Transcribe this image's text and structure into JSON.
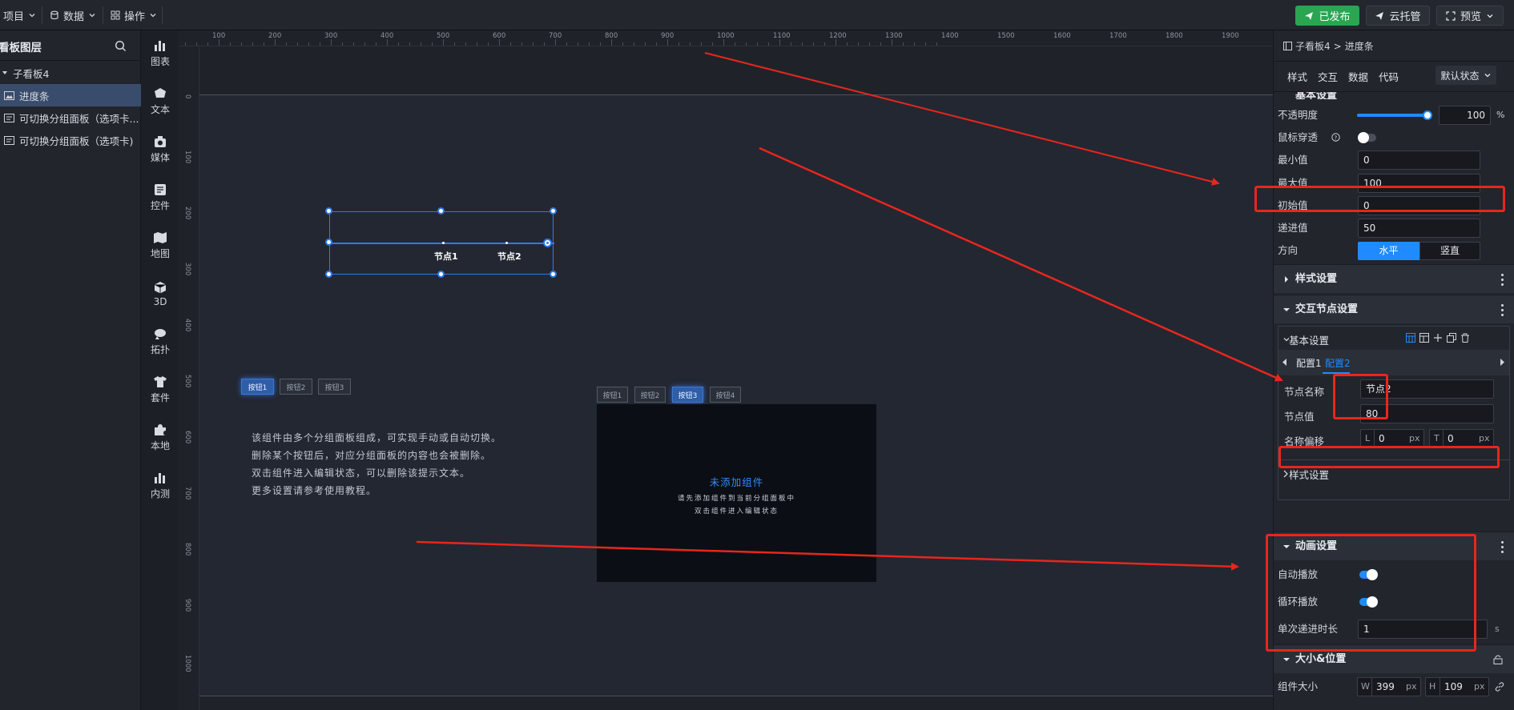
{
  "topbar": {
    "menus": [
      {
        "label": "项目",
        "icon": "menu-icon"
      },
      {
        "label": "数据",
        "icon": "database-icon"
      },
      {
        "label": "操作",
        "icon": "grid-icon"
      }
    ],
    "publish_label": "已发布",
    "hosting_label": "云托管",
    "preview_label": "预览"
  },
  "layers": {
    "title": "看板图层",
    "items": [
      {
        "label": "子看板4"
      },
      {
        "label": "进度条"
      },
      {
        "label": "可切换分组面板（选项卡..."
      },
      {
        "label": "可切换分组面板（选项卡)"
      }
    ]
  },
  "iconbar": {
    "items": [
      {
        "label": "图表",
        "icon": "chart-icon"
      },
      {
        "label": "文本",
        "icon": "text-icon"
      },
      {
        "label": "媒体",
        "icon": "media-icon"
      },
      {
        "label": "控件",
        "icon": "control-icon"
      },
      {
        "label": "地图",
        "icon": "map-icon"
      },
      {
        "label": "3D",
        "icon": "cube-icon"
      },
      {
        "label": "拓扑",
        "icon": "topology-icon"
      },
      {
        "label": "套件",
        "icon": "kit-icon"
      },
      {
        "label": "本地",
        "icon": "puzzle-icon"
      },
      {
        "label": "内测",
        "icon": "beta-chart-icon"
      }
    ]
  },
  "ruler": {
    "top_ticks": [
      "100",
      "200",
      "300",
      "400",
      "500",
      "600",
      "700",
      "800",
      "900",
      "1000",
      "1100",
      "1200",
      "1300",
      "1400",
      "1500",
      "1600",
      "1700",
      "1800",
      "1900"
    ],
    "left_ticks": [
      "0",
      "100",
      "200",
      "300",
      "400",
      "500",
      "600",
      "700",
      "800",
      "900",
      "1000"
    ]
  },
  "canvas": {
    "progress_nodes": [
      "节点1",
      "节点2"
    ],
    "tabs_left": [
      "按钮1",
      "按钮2",
      "按钮3"
    ],
    "description": [
      "该组件由多个分组面板组成，可实现手动或自动切换。",
      "删除某个按钮后，对应分组面板的内容也会被删除。",
      "双击组件进入编辑状态，可以删除该提示文本。",
      "更多设置请参考使用教程。"
    ],
    "tabs_right": [
      "按钮1",
      "按钮2",
      "按钮3",
      "按钮4"
    ],
    "empty_panel": {
      "title": "未添加组件",
      "line1": "请先添加组件到当前分组面板中",
      "line2": "双击组件进入编辑状态"
    }
  },
  "rpanel": {
    "breadcrumb_parent": "子看板4",
    "breadcrumb_sep": ">",
    "breadcrumb_current": "进度条",
    "tabs": [
      "样式",
      "交互",
      "数据",
      "代码"
    ],
    "state_select": "默认状态",
    "partial_section": "基本设置",
    "opacity_label": "不透明度",
    "opacity_value": "100",
    "opacity_unit": "%",
    "opacity_level": 1.0,
    "mouse_through_label": "鼠标穿透",
    "min_label": "最小值",
    "min_value": "0",
    "max_label": "最大值",
    "max_value": "100",
    "init_label": "初始值",
    "init_value": "0",
    "step_label": "递进值",
    "step_value": "50",
    "dir_label": "方向",
    "dir_h": "水平",
    "dir_v": "竖直",
    "style_section": "样式设置",
    "node_section": "交互节点设置",
    "basic_sub": "基本设置",
    "config_tabs": [
      "配置1",
      "配置2"
    ],
    "node_name_label": "节点名称",
    "node_name_value": "节点2",
    "node_value_label": "节点值",
    "node_value_value": "80",
    "name_offset_label": "名称偏移",
    "offset_l_tag": "L",
    "offset_l_value": "0",
    "offset_t_tag": "T",
    "offset_t_value": "0",
    "unit_px": "px",
    "style_sub": "样式设置",
    "anim_section": "动画设置",
    "autoplay_label": "自动播放",
    "loop_label": "循环播放",
    "duration_label": "单次递进时长",
    "duration_value": "1",
    "duration_unit": "s",
    "size_section": "大小&位置",
    "size_label": "组件大小",
    "w_tag": "W",
    "w_value": "399",
    "h_tag": "H",
    "h_value": "109",
    "colors": {
      "accent": "#1f8bff",
      "green": "#2aa552",
      "annotation": "#e8261c"
    }
  }
}
